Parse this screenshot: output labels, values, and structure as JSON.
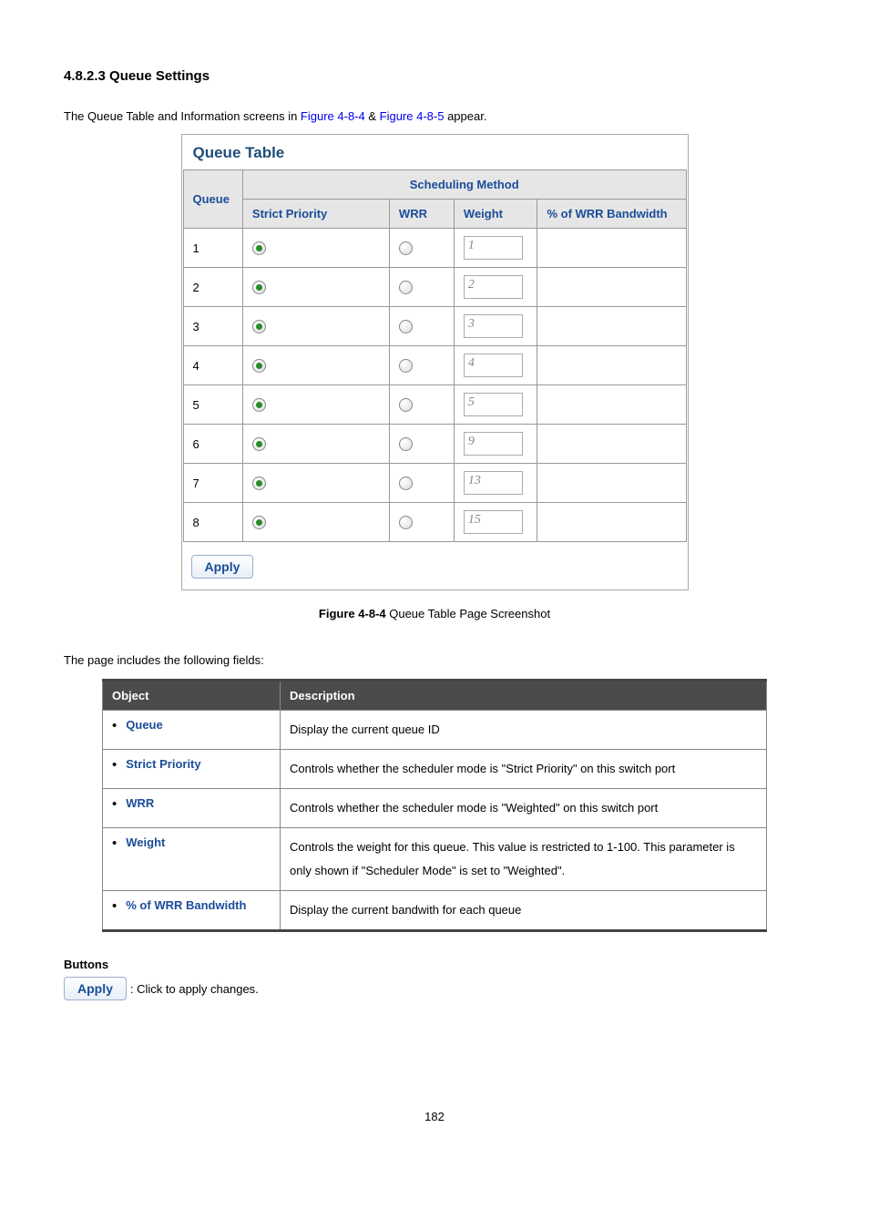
{
  "section_heading": "4.8.2.3 Queue Settings",
  "intro_prefix": "The Queue Table and Information screens in ",
  "intro_link1": "Figure 4-8-4",
  "intro_mid": " & ",
  "intro_link2": "Figure 4-8-5",
  "intro_suffix": " appear.",
  "panel_title": "Queue Table",
  "th_queue": "Queue",
  "th_sched": "Scheduling Method",
  "th_strict": "Strict Priority",
  "th_wrr": "WRR",
  "th_weight": "Weight",
  "th_bw": "% of WRR Bandwidth",
  "rows": [
    {
      "q": "1",
      "w": "1"
    },
    {
      "q": "2",
      "w": "2"
    },
    {
      "q": "3",
      "w": "3"
    },
    {
      "q": "4",
      "w": "4"
    },
    {
      "q": "5",
      "w": "5"
    },
    {
      "q": "6",
      "w": "9"
    },
    {
      "q": "7",
      "w": "13"
    },
    {
      "q": "8",
      "w": "15"
    }
  ],
  "apply_label": "Apply",
  "figure_caption_b": "Figure 4-8-4",
  "figure_caption_r": " Queue Table Page Screenshot",
  "fields_intro": "The page includes the following fields:",
  "fields_header_obj": "Object",
  "fields_header_desc": "Description",
  "fields": [
    {
      "name": "Queue",
      "desc": "Display the current queue ID"
    },
    {
      "name": "Strict Priority",
      "desc": "Controls whether the scheduler mode is \"Strict Priority\" on this switch port"
    },
    {
      "name": "WRR",
      "desc": "Controls whether the scheduler mode is \"Weighted\" on this switch port"
    },
    {
      "name": "Weight",
      "desc": "Controls the weight for this queue. This value is restricted to 1-100. This parameter is only shown if \"Scheduler Mode\" is set to \"Weighted\"."
    },
    {
      "name": "% of WRR Bandwidth",
      "desc": "Display the current bandwith for each queue"
    }
  ],
  "buttons_label": "Buttons",
  "apply_desc": ": Click to apply changes.",
  "page_number": "182"
}
